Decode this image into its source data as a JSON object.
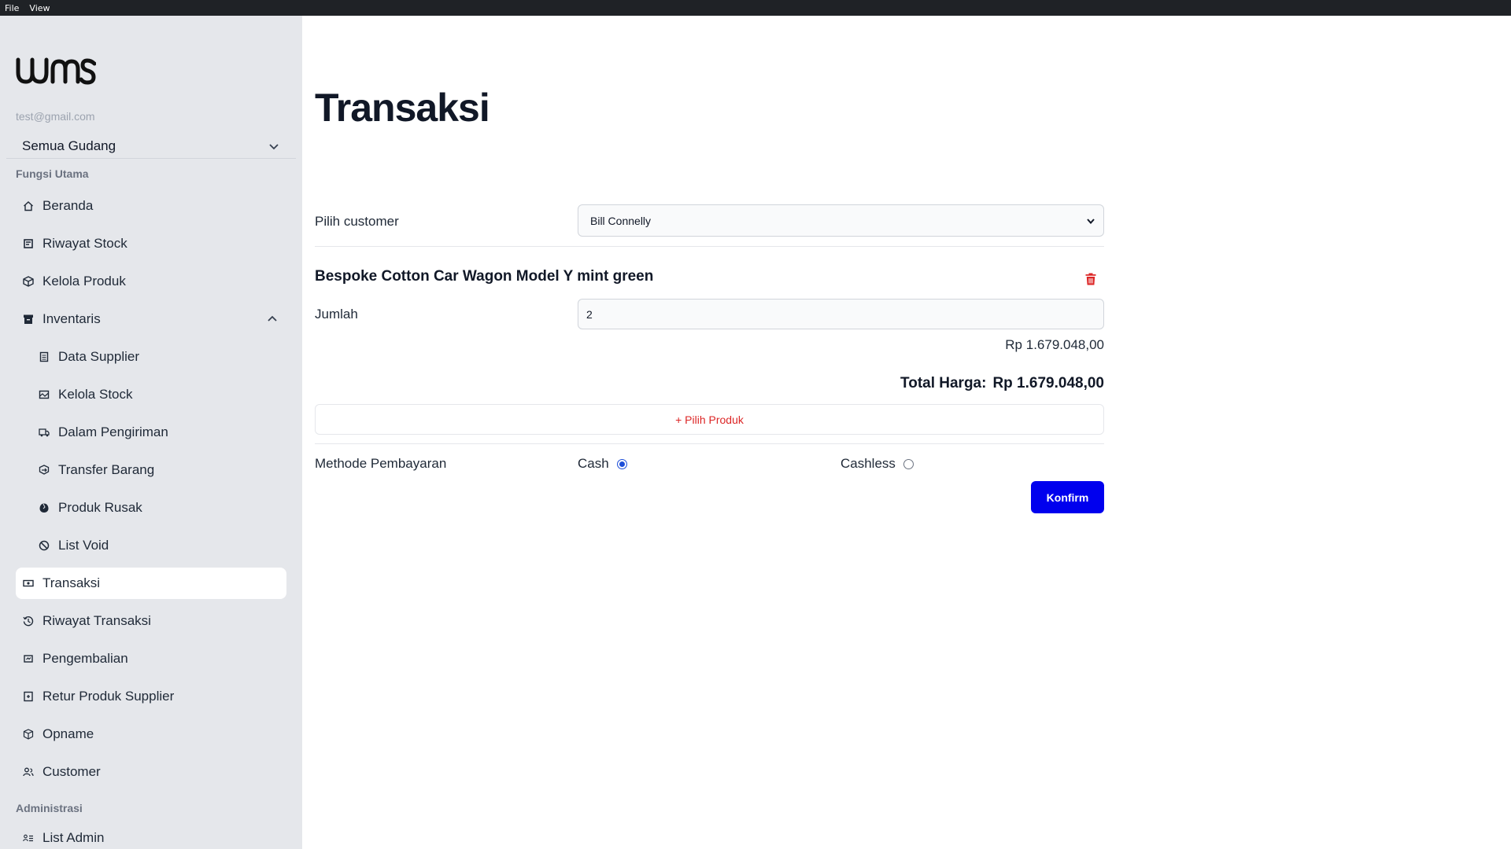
{
  "menubar": {
    "items": [
      "File",
      "View"
    ]
  },
  "sidebar": {
    "logo_text": "wms",
    "email": "test@gmail.com",
    "warehouse_select": "Semua Gudang",
    "section_main": "Fungsi Utama",
    "items": [
      {
        "label": "Beranda",
        "icon": "home-icon"
      },
      {
        "label": "Riwayat Stock",
        "icon": "history-icon"
      },
      {
        "label": "Kelola Produk",
        "icon": "box-icon"
      },
      {
        "label": "Inventaris",
        "icon": "archive-icon"
      },
      {
        "label": "Data Supplier",
        "icon": "list-icon"
      },
      {
        "label": "Kelola Stock",
        "icon": "stock-icon"
      },
      {
        "label": "Dalam Pengiriman",
        "icon": "truck-icon"
      },
      {
        "label": "Transfer Barang",
        "icon": "transfer-icon"
      },
      {
        "label": "Produk Rusak",
        "icon": "damaged-icon"
      },
      {
        "label": "List Void",
        "icon": "ban-icon"
      },
      {
        "label": "Transaksi",
        "icon": "money-icon"
      },
      {
        "label": "Riwayat Transaksi",
        "icon": "clock-icon"
      },
      {
        "label": "Pengembalian",
        "icon": "return-icon"
      },
      {
        "label": "Retur Produk Supplier",
        "icon": "return-supplier-icon"
      },
      {
        "label": "Opname",
        "icon": "package-icon"
      },
      {
        "label": "Customer",
        "icon": "users-icon"
      }
    ],
    "section_admin": "Administrasi",
    "admin_items": [
      {
        "label": "List Admin",
        "icon": "admin-list-icon"
      }
    ]
  },
  "main": {
    "title": "Transaksi",
    "customer_label": "Pilih customer",
    "customer_value": "Bill Connelly",
    "product_name": "Bespoke Cotton Car Wagon Model Y mint green",
    "qty_label": "Jumlah",
    "qty_value": "2",
    "subtotal": "Rp 1.679.048,00",
    "total_label": "Total Harga:",
    "total_value": "Rp 1.679.048,00",
    "add_product": "+ Pilih Produk",
    "payment_label": "Methode Pembayaran",
    "payment_options": [
      "Cash",
      "Cashless"
    ],
    "payment_selected": "Cash",
    "confirm": "Konfirm"
  },
  "colors": {
    "sidebar_bg": "#e5e7eb",
    "accent_red": "#dc2626",
    "confirm_blue": "#0000ee",
    "radio_blue": "#1d4ed8"
  }
}
